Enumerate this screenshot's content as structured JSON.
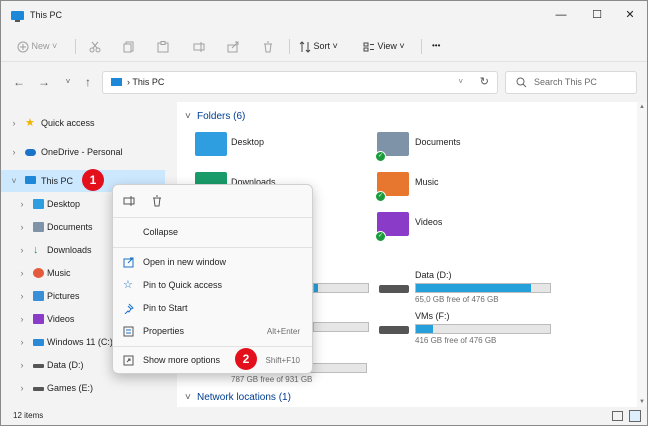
{
  "window": {
    "title": "This PC",
    "minimize": "—",
    "maximize": "☐",
    "close": "✕"
  },
  "toolbar": {
    "new_label": "New",
    "sort_label": "Sort",
    "view_label": "View",
    "more_label": "•••"
  },
  "address": {
    "path": "This PC",
    "refresh": "↻"
  },
  "search": {
    "placeholder": "Search This PC"
  },
  "sidebar": {
    "items": [
      {
        "label": "Quick access"
      },
      {
        "label": "OneDrive - Personal"
      },
      {
        "label": "This PC"
      },
      {
        "label": "Desktop"
      },
      {
        "label": "Documents"
      },
      {
        "label": "Downloads"
      },
      {
        "label": "Music"
      },
      {
        "label": "Pictures"
      },
      {
        "label": "Videos"
      },
      {
        "label": "Windows 11 (C:)"
      },
      {
        "label": "Data (D:)"
      },
      {
        "label": "Games (E:)"
      }
    ]
  },
  "main": {
    "folders_header": "Folders (6)",
    "folders": [
      {
        "label": "Desktop"
      },
      {
        "label": "Documents"
      },
      {
        "label": "Downloads"
      },
      {
        "label": "Music"
      },
      {
        "label": "Videos"
      }
    ],
    "drives": [
      {
        "label": "Data (D:)",
        "free": "65,0 GB free of 476 GB",
        "used_fraction": 0.86
      },
      {
        "label": "VMs (F:)",
        "free": "416 GB free of 476 GB",
        "used_fraction": 0.13
      },
      {
        "label": "",
        "free": "787 GB free of 931 GB",
        "used_fraction": 0.15
      }
    ],
    "network_header": "Network locations (1)"
  },
  "context_menu": {
    "items": [
      {
        "label": "Collapse",
        "key": ""
      },
      {
        "label": "Open in new window",
        "key": ""
      },
      {
        "label": "Pin to Quick access",
        "key": ""
      },
      {
        "label": "Pin to Start",
        "key": ""
      },
      {
        "label": "Properties",
        "key": "Alt+Enter"
      },
      {
        "label": "Show more options",
        "key": "Shift+F10"
      }
    ]
  },
  "badges": {
    "one": "1",
    "two": "2"
  },
  "status": {
    "items": "12 items"
  },
  "colors": {
    "accent": "#26a0da",
    "selection": "#cce8ff",
    "badge": "#e3101b"
  }
}
